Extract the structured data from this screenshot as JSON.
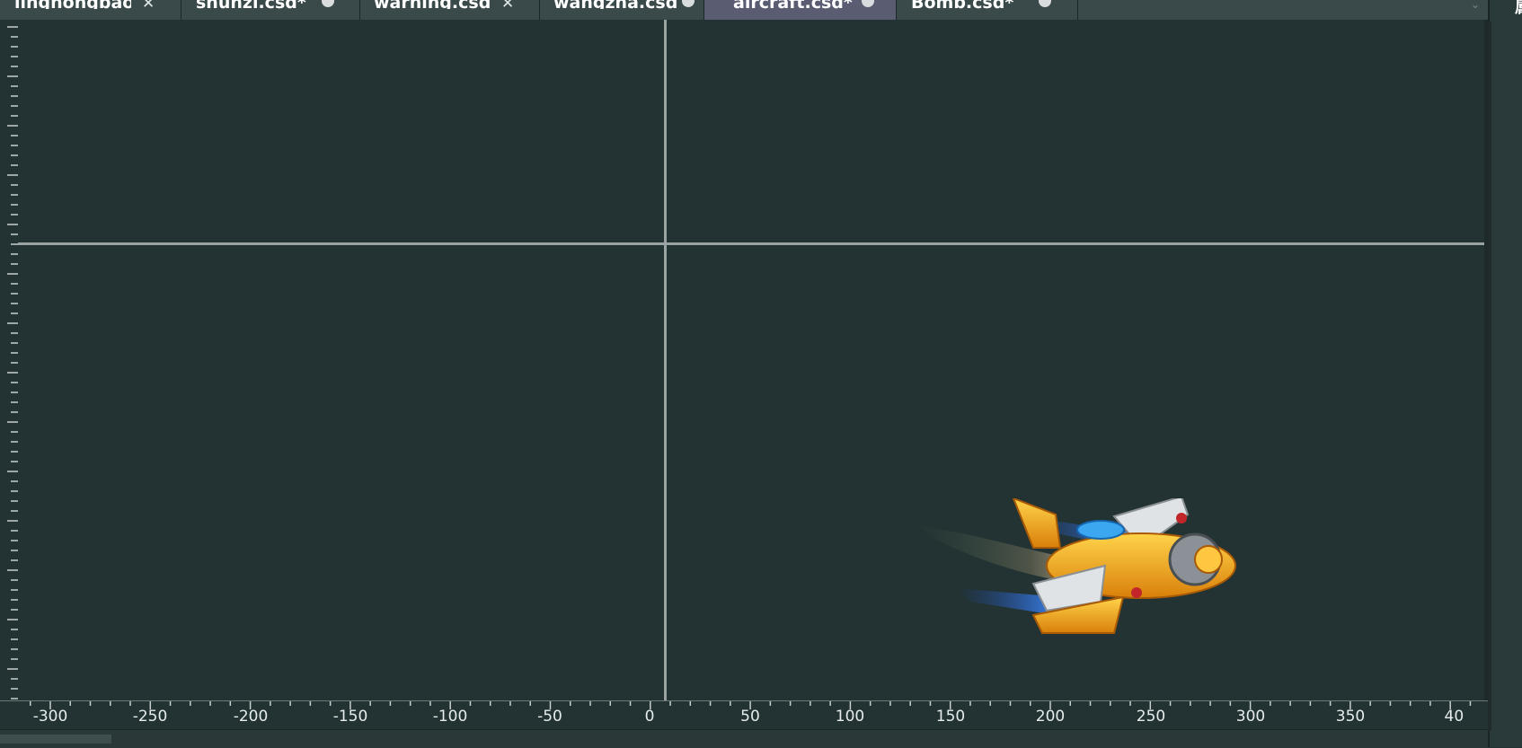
{
  "tabs": [
    {
      "label": "linghongbao",
      "control": "close",
      "active": false
    },
    {
      "label": "shunzi.csd*",
      "control": "dot",
      "active": false
    },
    {
      "label": "warning.csd",
      "control": "close",
      "active": false
    },
    {
      "label": "wangzha.csd",
      "control": "dot",
      "active": false
    },
    {
      "label": "aircraft.csd*",
      "control": "dot",
      "active": true
    },
    {
      "label": "Bomb.csd*",
      "control": "dot",
      "active": false
    }
  ],
  "close_glyph": "✕",
  "overflow_glyph": "⌄",
  "right_panel_glyph": "属",
  "ruler": {
    "labels": [
      "-300",
      "-250",
      "-200",
      "-150",
      "-100",
      "-50",
      "0",
      "50",
      "100",
      "150",
      "200",
      "250",
      "300",
      "350",
      "40"
    ]
  },
  "canvas": {
    "sprite": "aircraft-sprite",
    "axis_color": "#9aa2a2",
    "background": "#233333"
  },
  "colors": {
    "tab_active": "#5a5d72",
    "tabbar": "#3a4a4a",
    "sprite_body": "#f0a418",
    "sprite_wing": "#dfe3e6",
    "sprite_flame": "#2a78e0"
  }
}
